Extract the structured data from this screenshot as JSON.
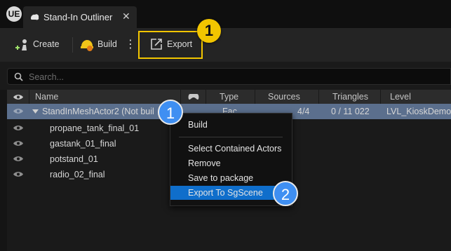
{
  "window": {
    "logo": "UE",
    "tab_title": "Stand-In Outliner",
    "tab_close": "✕"
  },
  "toolbar": {
    "create_label": "Create",
    "build_label": "Build",
    "more_glyph": "⋮",
    "export_label": "Export"
  },
  "search": {
    "placeholder": "Search..."
  },
  "columns": [
    "Name",
    "Type",
    "Sources",
    "Triangles",
    "Level"
  ],
  "rows": [
    {
      "name": "StandInMeshActor2 (Not buil",
      "type": "Fac",
      "sources": "4/4",
      "triangles": "0 / 11 022",
      "level": "LVL_KioskDemo"
    },
    {
      "name": "propane_tank_final_01"
    },
    {
      "name": "gastank_01_final"
    },
    {
      "name": "potstand_01"
    },
    {
      "name": "radio_02_final"
    }
  ],
  "context_menu": {
    "items": [
      "Build",
      "Select Contained Actors",
      "Remove",
      "Save to package",
      "Export To SgScene"
    ]
  },
  "callouts": {
    "one": "1",
    "two": "2"
  },
  "colors": {
    "accent_yellow": "#f2c500",
    "callout_blue": "#3f8ff2",
    "selection": "#5b6f8d",
    "menu_highlight": "#0f6ecb"
  }
}
